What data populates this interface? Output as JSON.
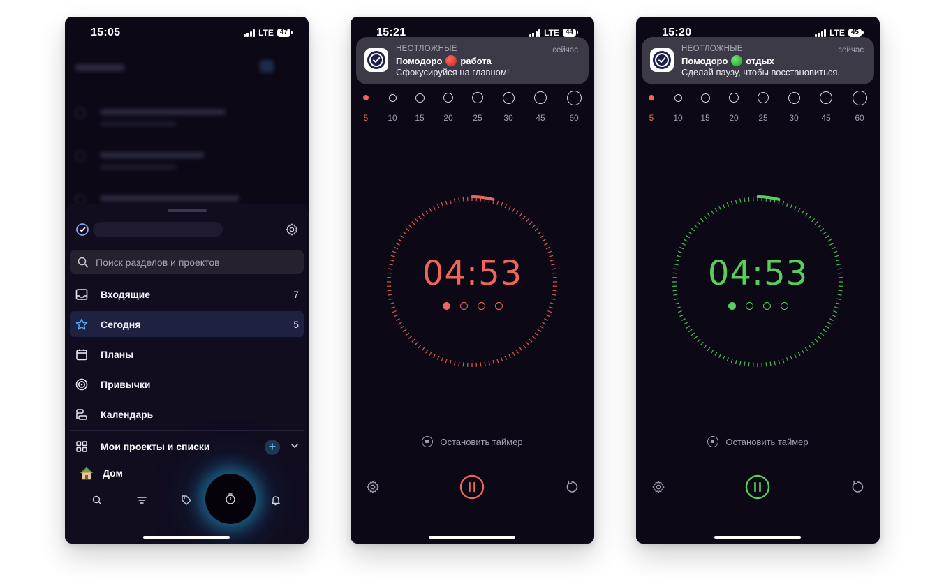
{
  "screens": {
    "drawer": {
      "status": {
        "time": "15:05",
        "network": "LTE",
        "battery": "47"
      },
      "search_placeholder": "Поиск разделов и проектов",
      "menu": [
        {
          "label": "Входящие",
          "count": "7",
          "icon": "inbox-icon"
        },
        {
          "label": "Сегодня",
          "count": "5",
          "icon": "star-icon",
          "active": true
        },
        {
          "label": "Планы",
          "count": "",
          "icon": "calendar-icon"
        },
        {
          "label": "Привычки",
          "count": "",
          "icon": "habits-icon"
        },
        {
          "label": "Календарь",
          "count": "",
          "icon": "timeline-icon"
        }
      ],
      "projects_label": "Мои проекты и списки",
      "home_item": "Дом",
      "tabs": [
        "search-icon",
        "filter-icon",
        "tag-icon",
        "timer-icon",
        "bell-icon"
      ]
    },
    "work": {
      "status": {
        "time": "15:21",
        "network": "LTE",
        "battery": "44"
      },
      "notification": {
        "app": "НЕОТЛОЖНЫЕ",
        "when": "сейчас",
        "title_prefix": "Помодоро",
        "title_suffix": "работа",
        "message": "Сфокусируйся на главном!",
        "dot_color": "#e5322d"
      },
      "timer": "04:53",
      "stop_label": "Остановить таймер",
      "accent": "#f0655b"
    },
    "rest": {
      "status": {
        "time": "15:20",
        "network": "LTE",
        "battery": "45"
      },
      "notification": {
        "app": "НЕОТЛОЖНЫЕ",
        "when": "сейчас",
        "title_prefix": "Помодоро",
        "title_suffix": "отдых",
        "message": "Сделай паузу, чтобы восстановиться.",
        "dot_color": "#27c23a"
      },
      "timer": "04:53",
      "stop_label": "Остановить таймер",
      "accent": "#57cf5a"
    }
  },
  "durations": [
    "5",
    "10",
    "15",
    "20",
    "25",
    "30",
    "45",
    "60"
  ],
  "timer_progress": 0.04,
  "cycles": {
    "total": 4,
    "completed": 1
  }
}
